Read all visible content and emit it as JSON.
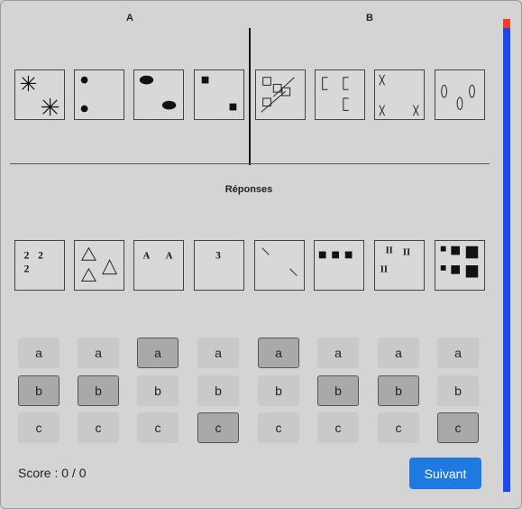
{
  "groups": {
    "a_label": "A",
    "b_label": "B"
  },
  "section_title": "Réponses",
  "answers": [
    {
      "options": [
        "a",
        "b",
        "c"
      ],
      "selected": "b"
    },
    {
      "options": [
        "a",
        "b",
        "c"
      ],
      "selected": "b"
    },
    {
      "options": [
        "a",
        "b",
        "c"
      ],
      "selected": "a"
    },
    {
      "options": [
        "a",
        "b",
        "c"
      ],
      "selected": "c"
    },
    {
      "options": [
        "a",
        "b",
        "c"
      ],
      "selected": "a"
    },
    {
      "options": [
        "a",
        "b",
        "c"
      ],
      "selected": "b"
    },
    {
      "options": [
        "a",
        "b",
        "c"
      ],
      "selected": "b"
    },
    {
      "options": [
        "a",
        "b",
        "c"
      ],
      "selected": "c"
    }
  ],
  "candidate_text": {
    "c1": "2 2 2",
    "c3": "A A",
    "c4": "3",
    "c7": "II II II"
  },
  "score_text": "Score : 0 / 0",
  "next_label": "Suivant",
  "progress": {
    "fraction": 0.02,
    "top_color": "#f04020",
    "bar_color": "#1e47f0"
  },
  "colors": {
    "accent": "#1e7ae0",
    "background": "#d4d4d4"
  }
}
